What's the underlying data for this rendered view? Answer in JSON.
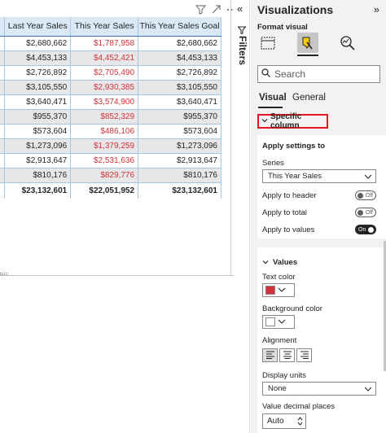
{
  "table": {
    "headers": [
      "",
      "Last Year Sales",
      "This Year Sales",
      "This Year Sales Goal"
    ],
    "rows": [
      [
        "$2,680,662",
        "$1,787,958",
        "$2,680,662"
      ],
      [
        "$4,453,133",
        "$4,452,421",
        "$4,453,133"
      ],
      [
        "$2,726,892",
        "$2,705,490",
        "$2,726,892"
      ],
      [
        "$3,105,550",
        "$2,930,385",
        "$3,105,550"
      ],
      [
        "$3,640,471",
        "$3,574,900",
        "$3,640,471"
      ],
      [
        "$955,370",
        "$852,329",
        "$955,370"
      ],
      [
        "$573,604",
        "$486,106",
        "$573,604"
      ],
      [
        "$1,273,096",
        "$1,379,259",
        "$1,273,096"
      ],
      [
        "$2,913,647",
        "$2,531,636",
        "$2,913,647"
      ],
      [
        "$810,176",
        "$829,776",
        "$810,176"
      ]
    ],
    "total": [
      "$23,132,601",
      "$22,051,952",
      "$23,132,601"
    ],
    "highlight_color": "#d13438"
  },
  "filters": {
    "label": "Filters"
  },
  "pane": {
    "title": "Visualizations",
    "subtitle": "Format visual",
    "search_placeholder": "Search",
    "tabs": [
      "Visual",
      "General"
    ],
    "specific_column": "Specific column",
    "apply_settings": {
      "heading": "Apply settings to",
      "series_label": "Series",
      "series_value": "This Year Sales",
      "apply_header_label": "Apply to header",
      "apply_header_state": "Off",
      "apply_total_label": "Apply to total",
      "apply_total_state": "Off",
      "apply_values_label": "Apply to values",
      "apply_values_state": "On"
    },
    "values": {
      "heading": "Values",
      "text_color_label": "Text color",
      "text_color": "#d13438",
      "background_color_label": "Background color",
      "background_color": "#ffffff",
      "alignment_label": "Alignment",
      "display_units_label": "Display units",
      "display_units_value": "None",
      "decimal_places_label": "Value decimal places",
      "decimal_places_value": "Auto"
    }
  }
}
